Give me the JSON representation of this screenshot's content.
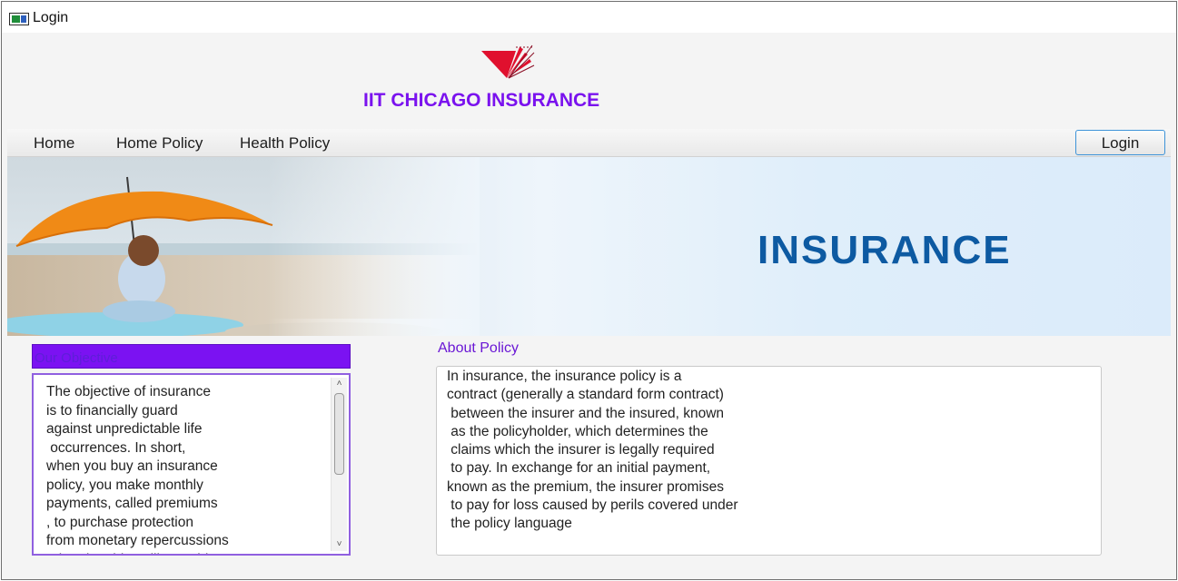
{
  "window": {
    "title": "Login",
    "icon": "app-window-icon"
  },
  "header": {
    "logo_icon": "iit-logo-icon",
    "company_name": "IIT CHICAGO INSURANCE"
  },
  "nav": {
    "items": [
      {
        "label": "Home"
      },
      {
        "label": "Home Policy"
      },
      {
        "label": "Health Policy"
      }
    ],
    "login_label": "Login"
  },
  "banner": {
    "word": "INSURANCE"
  },
  "objective": {
    "header": "Our Objective",
    "text": "The objective of insurance\nis to financially guard\nagainst unpredictable life\n occurrences. In short,\nwhen you buy an insurance\npolicy, you make monthly\npayments, called premiums\n, to purchase protection\nfrom monetary repercussions\nrelated to things like accidents"
  },
  "about": {
    "label": "About Policy",
    "text": "In insurance, the insurance policy is a\ncontract (generally a standard form contract)\n between the insurer and the insured, known\n as the policyholder, which determines the\n claims which the insurer is legally required\n to pay. In exchange for an initial payment,\nknown as the premium, the insurer promises\n to pay for loss caused by perils covered under\n the policy language"
  },
  "colors": {
    "accent_purple": "#7b12f2",
    "company_purple": "#7a12ee",
    "banner_text_blue": "#0d5aa2",
    "focus_blue": "#3d93d8"
  }
}
